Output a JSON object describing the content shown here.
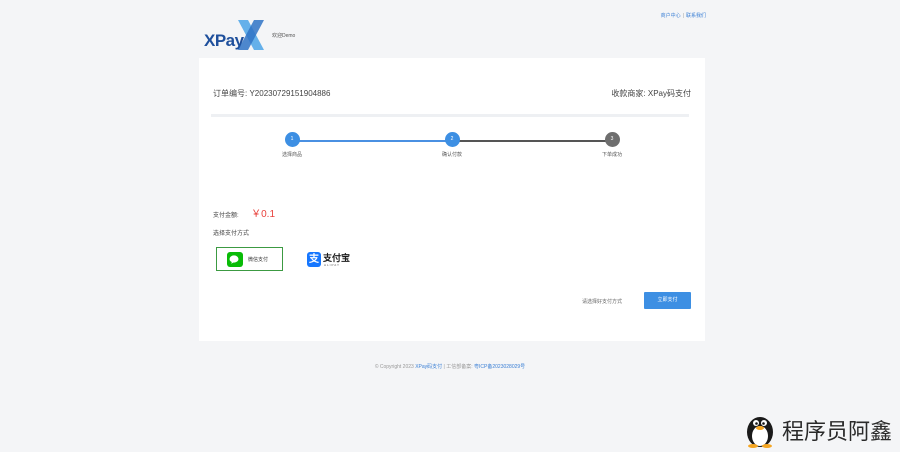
{
  "header": {
    "links": [
      "商户中心",
      "联系我们"
    ],
    "logo_text": "XPay",
    "welcome": "欢迎Demo"
  },
  "order": {
    "order_no_label": "订单编号:",
    "order_no": "Y20230729151904886",
    "merchant_label": "收款商家:",
    "merchant": "XPay码支付"
  },
  "steps": [
    {
      "num": "1",
      "label": "选择商品"
    },
    {
      "num": "2",
      "label": "确认付款"
    },
    {
      "num": "3",
      "label": "下单成功"
    }
  ],
  "payment": {
    "amount_label": "支付金额:",
    "amount": "￥0.1",
    "method_label": "选择支付方式",
    "wechat_label": "微信支付",
    "alipay_label": "支付宝",
    "alipay_sub": "ALIPAY"
  },
  "actions": {
    "hint": "请选择好支付方式",
    "confirm": "立即支付"
  },
  "footer": {
    "copyright": "© Copyright 2023",
    "brand": "XPay码支付",
    "sep": "|",
    "icp_label": "工信部备案:",
    "icp": "粤ICP备2023028029号"
  },
  "watermark": {
    "text": "程序员阿鑫"
  },
  "colors": {
    "accent": "#3d8fe3",
    "price": "#e8413c",
    "wechat": "#09bb07",
    "alipay": "#1677ff"
  }
}
